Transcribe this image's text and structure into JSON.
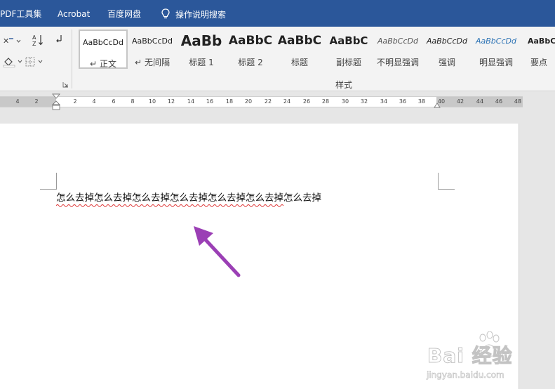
{
  "tabs": {
    "pdf_tools": "PDF工具集",
    "acrobat": "Acrobat",
    "baidu_pan": "百度网盘",
    "tell_me": "操作说明搜索"
  },
  "ribbon": {
    "styles": [
      {
        "sample": "AaBbCcDd",
        "label": "正文",
        "marker": "↵",
        "selected": true
      },
      {
        "sample": "AaBbCcDd",
        "label": "无间隔",
        "marker": "↵",
        "selected": false
      },
      {
        "sample": "AaBb",
        "label": "标题 1",
        "marker": "",
        "selected": false
      },
      {
        "sample": "AaBbC",
        "label": "标题 2",
        "marker": "",
        "selected": false
      },
      {
        "sample": "AaBbC",
        "label": "标题",
        "marker": "",
        "selected": false
      },
      {
        "sample": "AaBbC",
        "label": "副标题",
        "marker": "",
        "selected": false
      },
      {
        "sample": "AaBbCcDd",
        "label": "不明显强调",
        "marker": "",
        "selected": false
      },
      {
        "sample": "AaBbCcDd",
        "label": "强调",
        "marker": "",
        "selected": false
      },
      {
        "sample": "AaBbCcDd",
        "label": "明显强调",
        "marker": "",
        "selected": false
      },
      {
        "sample": "AaBbC",
        "label": "要点",
        "marker": "",
        "selected": false
      }
    ],
    "styles_group_label": "样式"
  },
  "ruler": {
    "ticks": [
      "4",
      "2",
      "2",
      "4",
      "6",
      "8",
      "10",
      "12",
      "14",
      "16",
      "18",
      "20",
      "22",
      "24",
      "26",
      "28",
      "30",
      "32",
      "34",
      "36",
      "38",
      "40",
      "42",
      "44",
      "46",
      "48"
    ]
  },
  "document": {
    "text": "怎么去掉怎么去掉怎么去掉怎么去掉怎么去掉怎么去掉怎么去掉"
  },
  "watermark": {
    "main": "Bai 经验",
    "sub": "jingyan.baidu.com"
  },
  "colors": {
    "tab_bar": "#2b579a",
    "arrow": "#9b3fb5",
    "squiggle": "#d33"
  }
}
